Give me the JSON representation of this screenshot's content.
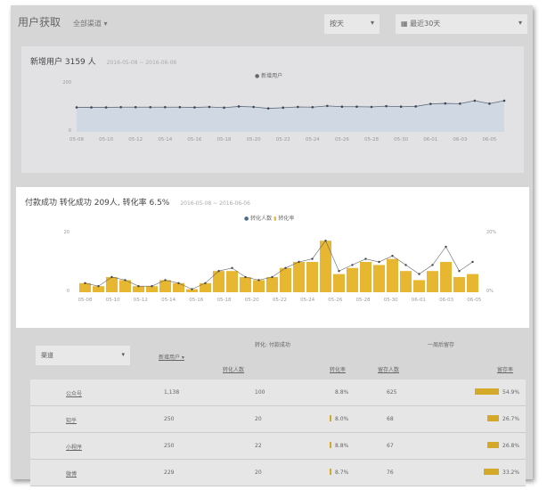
{
  "header": {
    "title": "用户获取",
    "channel": "全部渠道 ▾",
    "granularity": "按天",
    "range": "最近30天"
  },
  "chart1": {
    "title": "新增用户 3159 人",
    "dates": "2016-05-08 ~ 2016-06-06",
    "legend": "新增用户",
    "ymax_label": "200",
    "ymin_label": "0",
    "chart_data": {
      "type": "area",
      "x": [
        "05-08",
        "05-09",
        "05-10",
        "05-11",
        "05-12",
        "05-13",
        "05-14",
        "05-15",
        "05-16",
        "05-17",
        "05-18",
        "05-19",
        "05-20",
        "05-21",
        "05-22",
        "05-23",
        "05-24",
        "05-25",
        "05-26",
        "05-27",
        "05-28",
        "05-29",
        "05-30",
        "05-31",
        "06-01",
        "06-02",
        "06-03",
        "06-04",
        "06-05",
        "06-06"
      ],
      "series": [
        {
          "name": "新增用户",
          "values": [
            98,
            98,
            98,
            99,
            99,
            99,
            99,
            99,
            98,
            100,
            97,
            102,
            100,
            94,
            97,
            100,
            99,
            104,
            101,
            101,
            100,
            103,
            101,
            102,
            112,
            114,
            113,
            125,
            113,
            125
          ]
        }
      ],
      "ylim": [
        0,
        200
      ],
      "tick_labels": [
        "05-08",
        "05-10",
        "05-12",
        "05-14",
        "05-16",
        "05-18",
        "05-20",
        "05-22",
        "05-24",
        "05-26",
        "05-28",
        "05-30",
        "06-01",
        "06-03",
        "06-05"
      ]
    }
  },
  "chart2": {
    "title": "付款成功 转化成功 209人, 转化率 6.5%",
    "dates": "2016-05-08 ~ 2016-06-06",
    "legend": [
      "转化人数",
      "转化率"
    ],
    "yleft": [
      "20",
      "0"
    ],
    "yright": [
      "20%",
      "0%"
    ],
    "chart_data": {
      "type": "bar",
      "ylim": [
        0,
        20
      ],
      "series": [
        {
          "name": "转化人数",
          "values": [
            3,
            2,
            5,
            4,
            2,
            2,
            4,
            3,
            1,
            3,
            7,
            7,
            5,
            4,
            5,
            8,
            10,
            10,
            17,
            6,
            8,
            10,
            9,
            11,
            7,
            4,
            7,
            10,
            5,
            6
          ]
        },
        {
          "name": "转化率",
          "values": [
            3,
            2,
            5,
            4,
            2,
            2,
            4,
            3,
            1,
            3,
            7,
            8,
            5,
            4,
            5,
            8,
            10,
            11,
            17,
            7,
            9,
            11,
            10,
            12,
            9,
            6,
            9,
            15,
            7,
            10
          ]
        }
      ]
    }
  },
  "table": {
    "filter": "渠道",
    "col_new": "新增用户 ▾",
    "group_conv": "转化: 付款成功",
    "group_ret": "一周后留存",
    "cols": [
      "转化人数",
      "转化率",
      "留存人数",
      "留存率"
    ],
    "rows": [
      {
        "name": "公众号",
        "new": "1,138",
        "conv": "100",
        "rate": "8.8%",
        "ret": "625",
        "rrate": "54.9%",
        "rv": 54.9,
        "cv": 0
      },
      {
        "name": "知乎",
        "new": "250",
        "conv": "20",
        "rate": "8.0%",
        "ret": "68",
        "rrate": "26.7%",
        "rv": 26.7,
        "cv": 8
      },
      {
        "name": "小程序",
        "new": "250",
        "conv": "22",
        "rate": "8.8%",
        "ret": "67",
        "rrate": "26.8%",
        "rv": 26.8,
        "cv": 8.8
      },
      {
        "name": "微博",
        "new": "229",
        "conv": "20",
        "rate": "8.7%",
        "ret": "76",
        "rrate": "33.2%",
        "rv": 33.2,
        "cv": 8.7
      }
    ]
  },
  "colors": {
    "bar": "#e8b731",
    "area": "#c9d6e3",
    "line": "#5a6a7a"
  }
}
